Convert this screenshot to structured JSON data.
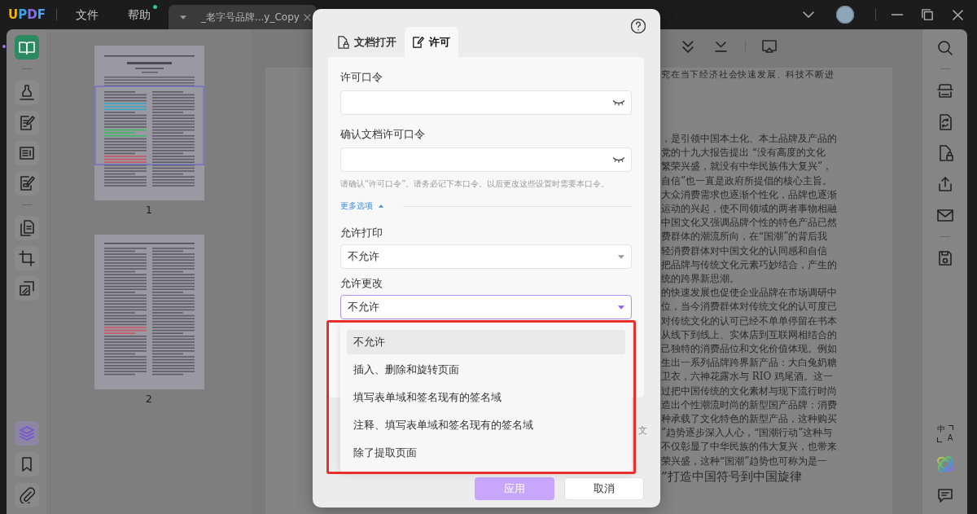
{
  "title_bar": {
    "logo": "UPDF",
    "menus": [
      {
        "label": "文件",
        "dot": false
      },
      {
        "label": "帮助",
        "dot": true
      }
    ],
    "tab": {
      "title": "_老字号品牌...y_Copy"
    }
  },
  "left_toolbar": {
    "tools": [
      {
        "selected": true
      },
      {
        "selected": false
      },
      {
        "selected": false
      },
      {
        "selected": false
      },
      {
        "selected": false
      },
      {
        "selected": false
      },
      {
        "selected": false
      },
      {
        "selected": false
      }
    ],
    "panels": [
      {
        "selected": true
      },
      {
        "selected": false
      },
      {
        "selected": false
      }
    ]
  },
  "thumbnails": [
    {
      "page": "1",
      "selected": true
    },
    {
      "page": "2",
      "selected": false
    }
  ],
  "document": {
    "top_line": "究在当下经济社会快速发展、科技不断进",
    "lines": [
      "，是引领中国本土化、本土品牌及产品的",
      "党的十九大报告提出 “没有高度的文化",
      "繁荣兴盛，就没有中华民族伟大复兴”，",
      "自信”也一直是政府所提倡的核心主旨。",
      "大众消费需求也逐渐个性化，品牌也逐渐",
      "运动的兴起，使不同领域的两者事物相融",
      "中国文化又强调品牌个性的特色产品已然",
      "费群体的潮流所向，在“国潮”的背后我",
      "轻消费群体对中国文化的认同感和自信",
      "把品牌与传统文化元素巧妙结合，产生的",
      "统的跨界新思潮。",
      "的快速发展也促使企业品牌在市场调研中",
      "位，当今消费群体对传统文化的认可度已",
      "对传统文化的认可已经不单单停留在书本",
      "从线下到线上、实体店到互联网相结合的",
      "己独特的消费品位和文化价值体现。例如",
      "生出一系列品牌跨界新产品：大白兔奶糖",
      "卫衣，六神花露水与 RIO 鸡尾酒。这一",
      "过把中国传统的文化素材与现下流行时尚",
      "造出个性潮流时尚的新型国产品牌：消费",
      "种承载了文化特色的新型产品，这种购买",
      "”趋势逐步深入人心，“国潮行动”这种与",
      "不仅彰显了中华民族的伟大复兴，也带来",
      "荣兴盛，这种“国潮”趋势也可称为是一"
    ],
    "heading": "”打造中国符号到中国旋律"
  },
  "right_toolbar": {
    "translate": [
      "中",
      "A"
    ]
  },
  "dialog": {
    "tabs": [
      {
        "label": "文档打开",
        "selected": false
      },
      {
        "label": "许可",
        "selected": true
      }
    ],
    "password_fields": [
      {
        "label": "许可口令"
      },
      {
        "label": "确认文档许可口令"
      }
    ],
    "hint": "请确认“许可口令”。请务必记下本口令。以后更改这些设置时需要本口令。",
    "more_options": {
      "label": "更多选项",
      "expanded": true
    },
    "selects": [
      {
        "label": "允许打印",
        "value": "不允许",
        "open": false
      },
      {
        "label": "允许更改",
        "value": "不允许",
        "open": true,
        "options": [
          {
            "label": "不允许",
            "selected": true
          },
          {
            "label": "插入、删除和旋转页面",
            "selected": false
          },
          {
            "label": "填写表单域和签名现有的签名域",
            "selected": false
          },
          {
            "label": "注释、填写表单域和签名现有的签名域",
            "selected": false
          },
          {
            "label": "除了提取页面",
            "selected": false
          }
        ]
      }
    ],
    "covered_text": "文",
    "buttons": [
      {
        "label": "应用",
        "kind": "primary",
        "disabled": true
      },
      {
        "label": "取消",
        "kind": "secondary",
        "disabled": false
      }
    ]
  }
}
